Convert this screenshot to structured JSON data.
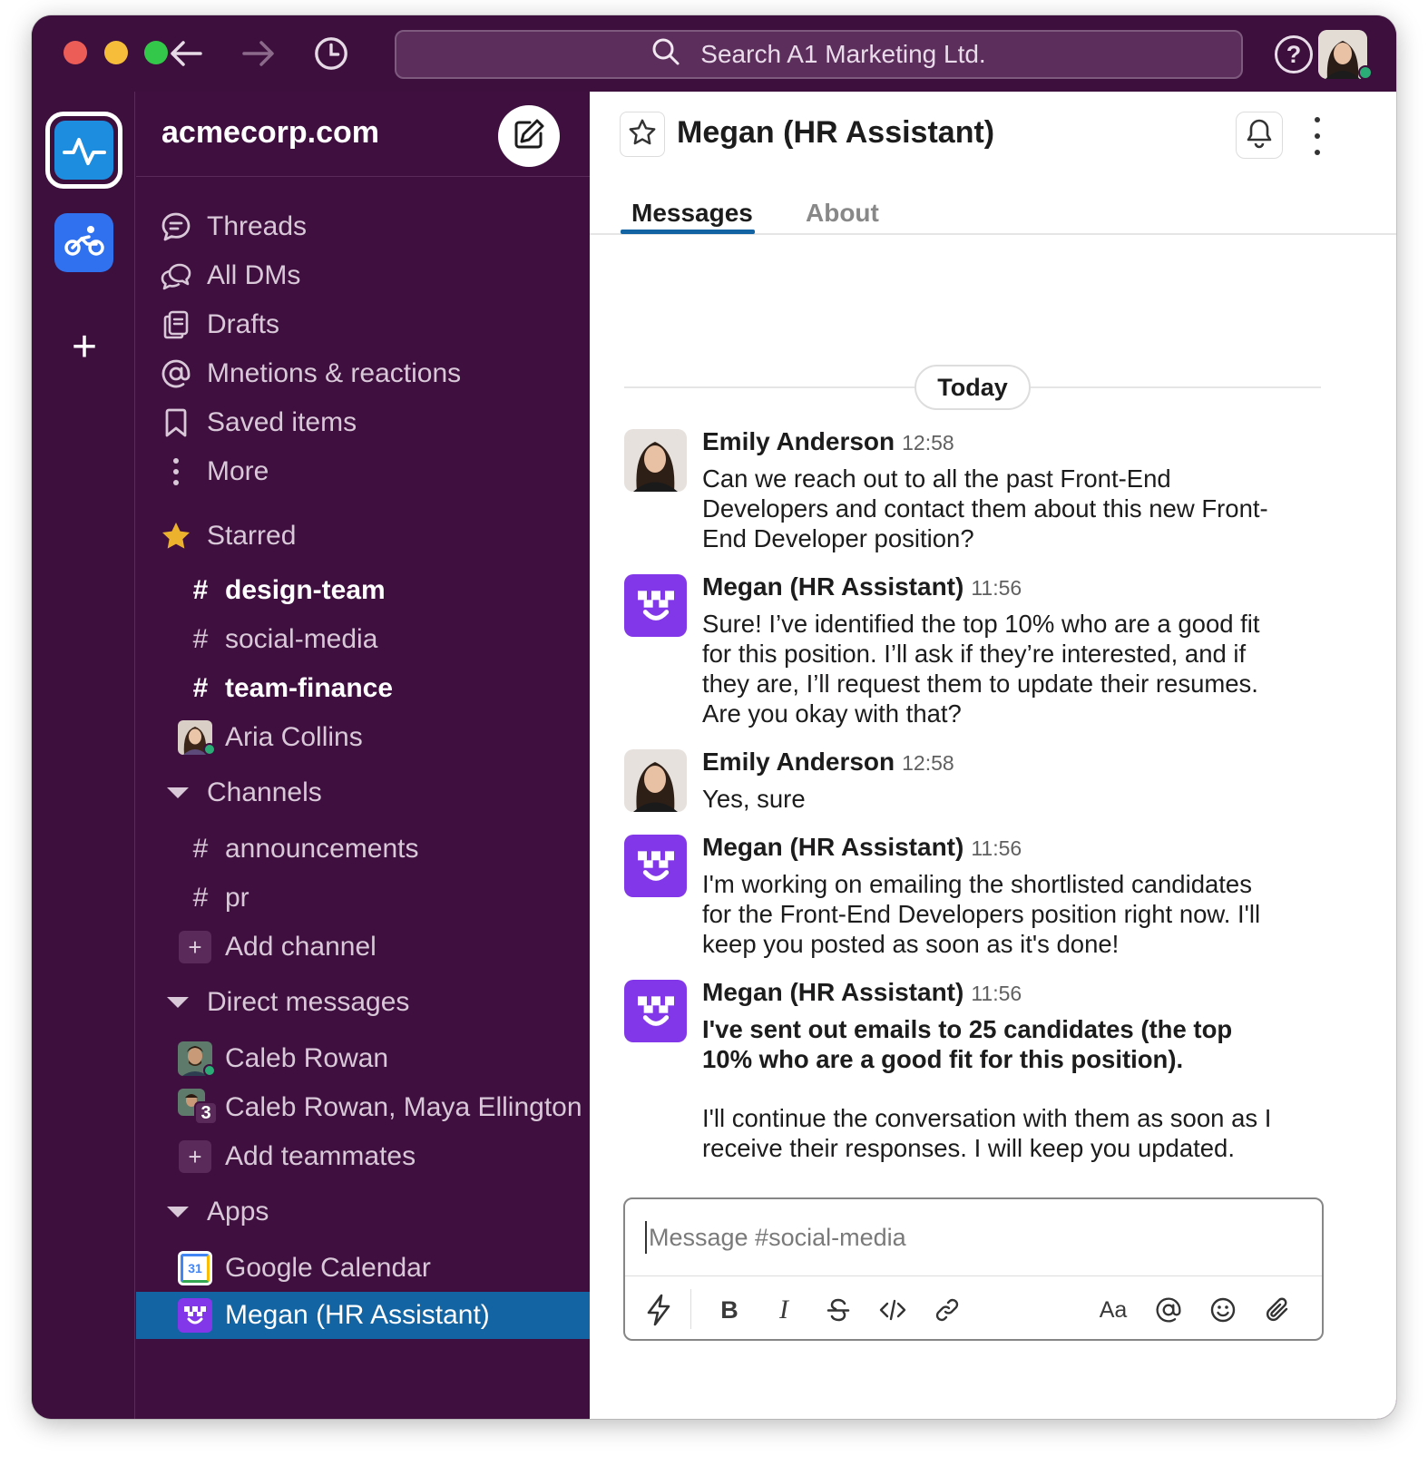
{
  "titlebar": {
    "search_placeholder": "Search A1 Marketing Ltd.",
    "help_label": "?"
  },
  "rail": {
    "add_label": "+"
  },
  "sidebar": {
    "workspace_name": "acmecorp.com",
    "nav": [
      {
        "label": "Threads",
        "icon": "threads-icon"
      },
      {
        "label": "All DMs",
        "icon": "dms-icon"
      },
      {
        "label": "Drafts",
        "icon": "drafts-icon"
      },
      {
        "label": "Mnetions & reactions",
        "icon": "mention-icon"
      },
      {
        "label": "Saved items",
        "icon": "bookmark-icon"
      },
      {
        "label": "More",
        "icon": "more-vertical-icon"
      }
    ],
    "starred": {
      "label": "Starred",
      "items": [
        {
          "label": "design-team",
          "prefix": "#",
          "bold": true
        },
        {
          "label": "social-media",
          "prefix": "#",
          "bold": false
        },
        {
          "label": "team-finance",
          "prefix": "#",
          "bold": true
        },
        {
          "label": "Aria Collins",
          "prefix": "avatar",
          "bold": false
        }
      ]
    },
    "channels": {
      "label": "Channels",
      "items": [
        {
          "label": "announcements",
          "prefix": "#"
        },
        {
          "label": "pr",
          "prefix": "#"
        }
      ],
      "add_label": "Add channel"
    },
    "direct_messages": {
      "label": "Direct messages",
      "items": [
        {
          "label": "Caleb Rowan"
        },
        {
          "label": "Caleb Rowan, Maya Ellington ...",
          "count": "3"
        }
      ],
      "add_label": "Add teammates"
    },
    "apps": {
      "label": "Apps",
      "items": [
        {
          "label": "Google Calendar",
          "icon_text": "31"
        },
        {
          "label": "Megan (HR Assistant)",
          "selected": true
        }
      ]
    }
  },
  "main": {
    "title": "Megan (HR Assistant)",
    "tabs": [
      {
        "label": "Messages",
        "active": true
      },
      {
        "label": "About",
        "active": false
      }
    ],
    "date_divider": "Today",
    "messages": [
      {
        "author": "Emily Anderson",
        "time": "12:58",
        "text": "Can we reach out to all the past Front-End Developers and contact them about this new Front-End Developer position?"
      },
      {
        "author": "Megan (HR Assistant)",
        "time": "11:56",
        "text": "Sure! I’ve identified the top 10% who are a good fit for this position. I’ll ask if they’re interested, and if they are, I’ll request them to update their resumes. Are you okay with that?"
      },
      {
        "author": "Emily Anderson",
        "time": "12:58",
        "text": "Yes, sure"
      },
      {
        "author": "Megan (HR Assistant)",
        "time": "11:56",
        "text": "I'm working on emailing the shortlisted candidates for the Front-End Developers position right now. I'll keep you posted as soon as it's done!"
      },
      {
        "author": "Megan (HR Assistant)",
        "time": "11:56",
        "text_bold": "I've sent out emails to 25 candidates (the top 10% who are a good fit for this position).",
        "text": "I'll continue the conversation with them as soon as I receive their responses. I will keep you updated."
      }
    ],
    "composer": {
      "placeholder": "Message #social-media",
      "format_labels": {
        "bold": "B",
        "italic": "I",
        "text_style": "Aa"
      }
    }
  },
  "colors": {
    "sidebar_bg": "#3f0f3f",
    "selected_item": "#1264a3",
    "bot_avatar": "#8238e8",
    "presence_online": "#2bac76",
    "workspace_active": "#1d8de0",
    "workspace_secondary": "#3071f0"
  }
}
